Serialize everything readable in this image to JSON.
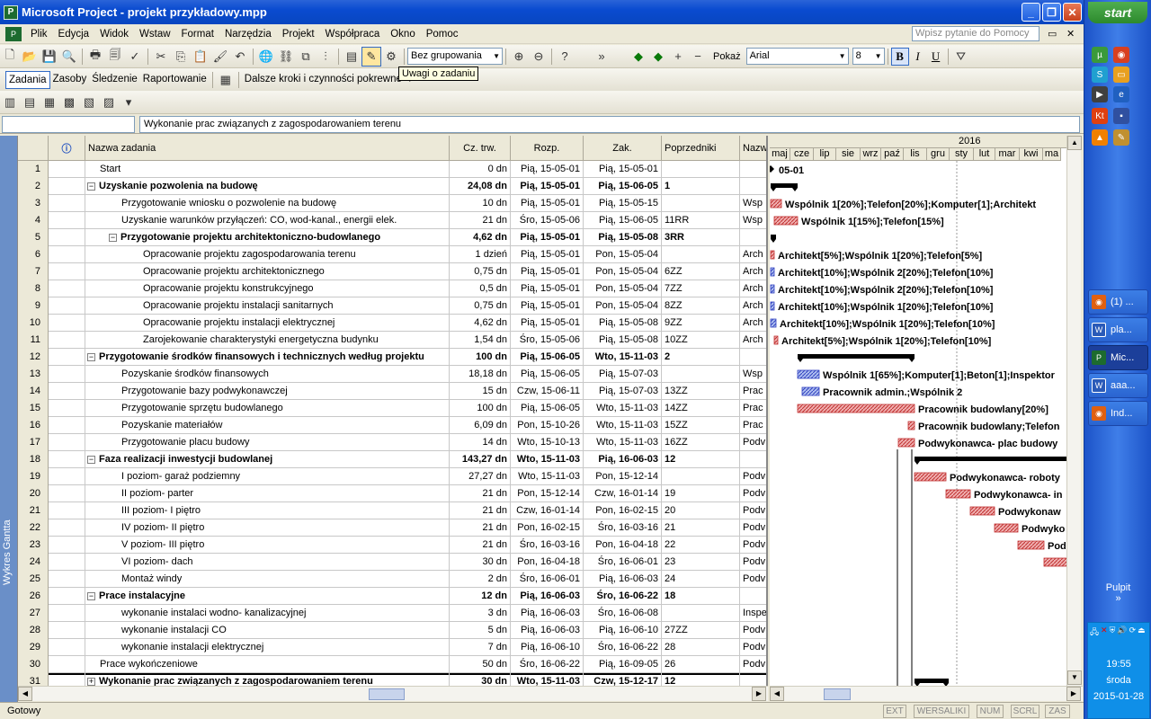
{
  "window": {
    "title": "Microsoft Project - projekt przykładowy.mpp"
  },
  "menu": [
    "Plik",
    "Edycja",
    "Widok",
    "Wstaw",
    "Format",
    "Narzędzia",
    "Projekt",
    "Współpraca",
    "Okno",
    "Pomoc"
  ],
  "ask_placeholder": "Wpisz pytanie do Pomocy",
  "toolbar": {
    "grouping": "Bez grupowania",
    "show_label": "Pokaż",
    "font": "Arial",
    "size": "8"
  },
  "guide": {
    "tabs": [
      "Zadania",
      "Zasoby",
      "Śledzenie",
      "Raportowanie"
    ],
    "next_steps": "Dalsze kroki i czynności pokrewne"
  },
  "tooltip": "Uwagi o zadaniu",
  "entry_value": "Wykonanie prac związanych z zagospodarowaniem terenu",
  "sidebar_label": "Wykres Gantta",
  "columns": [
    "Nazwa zadania",
    "Cz. trw.",
    "Rozp.",
    "Zak.",
    "Poprzedniki",
    "Nazw"
  ],
  "tasks": [
    {
      "id": "1",
      "name": "Start",
      "dur": "0 dn",
      "start": "Pią, 15-05-01",
      "finish": "Pią, 15-05-01",
      "pred": "",
      "res": "",
      "level": 0,
      "summary": false
    },
    {
      "id": "2",
      "name": "Uzyskanie pozwolenia na budowę",
      "dur": "24,08 dn",
      "start": "Pią, 15-05-01",
      "finish": "Pią, 15-06-05",
      "pred": "1",
      "res": "",
      "level": 0,
      "summary": true
    },
    {
      "id": "3",
      "name": "Przygotowanie wniosku o pozwolenie na budowę",
      "dur": "10 dn",
      "start": "Pią, 15-05-01",
      "finish": "Pią, 15-05-15",
      "pred": "",
      "res": "Wsp",
      "level": 1,
      "summary": false
    },
    {
      "id": "4",
      "name": "Uzyskanie warunków przyłączeń: CO, wod-kanal., energii elek.",
      "dur": "21 dn",
      "start": "Śro, 15-05-06",
      "finish": "Pią, 15-06-05",
      "pred": "11RR",
      "res": "Wsp",
      "level": 1,
      "summary": false
    },
    {
      "id": "5",
      "name": "Przygotowanie projektu architektoniczno-budowlanego",
      "dur": "4,62 dn",
      "start": "Pią, 15-05-01",
      "finish": "Pią, 15-05-08",
      "pred": "3RR",
      "res": "",
      "level": 1,
      "summary": true
    },
    {
      "id": "6",
      "name": "Opracowanie projektu zagospodarowania terenu",
      "dur": "1 dzień",
      "start": "Pią, 15-05-01",
      "finish": "Pon, 15-05-04",
      "pred": "",
      "res": "Arch",
      "level": 2,
      "summary": false
    },
    {
      "id": "7",
      "name": "Opracowanie projektu architektonicznego",
      "dur": "0,75 dn",
      "start": "Pią, 15-05-01",
      "finish": "Pon, 15-05-04",
      "pred": "6ZZ",
      "res": "Arch",
      "level": 2,
      "summary": false
    },
    {
      "id": "8",
      "name": "Opracowanie projektu konstrukcyjnego",
      "dur": "0,5 dn",
      "start": "Pią, 15-05-01",
      "finish": "Pon, 15-05-04",
      "pred": "7ZZ",
      "res": "Arch",
      "level": 2,
      "summary": false
    },
    {
      "id": "9",
      "name": "Opracowanie projektu instalacji sanitarnych",
      "dur": "0,75 dn",
      "start": "Pią, 15-05-01",
      "finish": "Pon, 15-05-04",
      "pred": "8ZZ",
      "res": "Arch",
      "level": 2,
      "summary": false
    },
    {
      "id": "10",
      "name": "Opracowanie projektu instalacji elektrycznej",
      "dur": "4,62 dn",
      "start": "Pią, 15-05-01",
      "finish": "Pią, 15-05-08",
      "pred": "9ZZ",
      "res": "Arch",
      "level": 2,
      "summary": false
    },
    {
      "id": "11",
      "name": "Zarojekowanie charakterystyki energetyczna budynku",
      "dur": "1,54 dn",
      "start": "Śro, 15-05-06",
      "finish": "Pią, 15-05-08",
      "pred": "10ZZ",
      "res": "Arch",
      "level": 2,
      "summary": false
    },
    {
      "id": "12",
      "name": "Przygotowanie środków finansowych i technicznych według projektu",
      "dur": "100 dn",
      "start": "Pią, 15-06-05",
      "finish": "Wto, 15-11-03",
      "pred": "2",
      "res": "",
      "level": 0,
      "summary": true
    },
    {
      "id": "13",
      "name": "Pozyskanie środków finansowych",
      "dur": "18,18 dn",
      "start": "Pią, 15-06-05",
      "finish": "Pią, 15-07-03",
      "pred": "",
      "res": "Wsp",
      "level": 1,
      "summary": false
    },
    {
      "id": "14",
      "name": "Przygotowanie bazy podwykonawczej",
      "dur": "15 dn",
      "start": "Czw, 15-06-11",
      "finish": "Pią, 15-07-03",
      "pred": "13ZZ",
      "res": "Prac",
      "level": 1,
      "summary": false
    },
    {
      "id": "15",
      "name": "Przygotowanie sprzętu budowlanego",
      "dur": "100 dn",
      "start": "Pią, 15-06-05",
      "finish": "Wto, 15-11-03",
      "pred": "14ZZ",
      "res": "Prac",
      "level": 1,
      "summary": false
    },
    {
      "id": "16",
      "name": "Pozyskanie materiałów",
      "dur": "6,09 dn",
      "start": "Pon, 15-10-26",
      "finish": "Wto, 15-11-03",
      "pred": "15ZZ",
      "res": "Prac",
      "level": 1,
      "summary": false
    },
    {
      "id": "17",
      "name": "Przygotowanie placu budowy",
      "dur": "14 dn",
      "start": "Wto, 15-10-13",
      "finish": "Wto, 15-11-03",
      "pred": "16ZZ",
      "res": "Podv",
      "level": 1,
      "summary": false
    },
    {
      "id": "18",
      "name": "Faza realizacji inwestycji budowlanej",
      "dur": "143,27 dn",
      "start": "Wto, 15-11-03",
      "finish": "Pią, 16-06-03",
      "pred": "12",
      "res": "",
      "level": 0,
      "summary": true
    },
    {
      "id": "19",
      "name": "I poziom- garaż podziemny",
      "dur": "27,27 dn",
      "start": "Wto, 15-11-03",
      "finish": "Pon, 15-12-14",
      "pred": "",
      "res": "Podv",
      "level": 1,
      "summary": false
    },
    {
      "id": "20",
      "name": "II poziom- parter",
      "dur": "21 dn",
      "start": "Pon, 15-12-14",
      "finish": "Czw, 16-01-14",
      "pred": "19",
      "res": "Podv",
      "level": 1,
      "summary": false
    },
    {
      "id": "21",
      "name": "III poziom- I piętro",
      "dur": "21 dn",
      "start": "Czw, 16-01-14",
      "finish": "Pon, 16-02-15",
      "pred": "20",
      "res": "Podv",
      "level": 1,
      "summary": false
    },
    {
      "id": "22",
      "name": "IV poziom- II piętro",
      "dur": "21 dn",
      "start": "Pon, 16-02-15",
      "finish": "Śro, 16-03-16",
      "pred": "21",
      "res": "Podv",
      "level": 1,
      "summary": false
    },
    {
      "id": "23",
      "name": "V poziom- III piętro",
      "dur": "21 dn",
      "start": "Śro, 16-03-16",
      "finish": "Pon, 16-04-18",
      "pred": "22",
      "res": "Podv",
      "level": 1,
      "summary": false
    },
    {
      "id": "24",
      "name": "VI poziom- dach",
      "dur": "30 dn",
      "start": "Pon, 16-04-18",
      "finish": "Śro, 16-06-01",
      "pred": "23",
      "res": "Podv",
      "level": 1,
      "summary": false
    },
    {
      "id": "25",
      "name": "Montaż windy",
      "dur": "2 dn",
      "start": "Śro, 16-06-01",
      "finish": "Pią, 16-06-03",
      "pred": "24",
      "res": "Podv",
      "level": 1,
      "summary": false
    },
    {
      "id": "26",
      "name": "Prace instalacyjne",
      "dur": "12 dn",
      "start": "Pią, 16-06-03",
      "finish": "Śro, 16-06-22",
      "pred": "18",
      "res": "",
      "level": 0,
      "summary": true
    },
    {
      "id": "27",
      "name": "wykonanie instalaci wodno- kanalizacyjnej",
      "dur": "3 dn",
      "start": "Pią, 16-06-03",
      "finish": "Śro, 16-06-08",
      "pred": "",
      "res": "Inspe",
      "level": 1,
      "summary": false
    },
    {
      "id": "28",
      "name": "wykonanie instalacji CO",
      "dur": "5 dn",
      "start": "Pią, 16-06-03",
      "finish": "Pią, 16-06-10",
      "pred": "27ZZ",
      "res": "Podv",
      "level": 1,
      "summary": false
    },
    {
      "id": "29",
      "name": "wykonanie instalacji elektrycznej",
      "dur": "7 dn",
      "start": "Pią, 16-06-10",
      "finish": "Śro, 16-06-22",
      "pred": "28",
      "res": "Podv",
      "level": 1,
      "summary": false
    },
    {
      "id": "30",
      "name": "Prace wykończeniowe",
      "dur": "50 dn",
      "start": "Śro, 16-06-22",
      "finish": "Pią, 16-09-05",
      "pred": "26",
      "res": "Podv",
      "level": 0,
      "summary": false
    },
    {
      "id": "31",
      "name": "Wykonanie prac związanych z zagospodarowaniem terenu",
      "dur": "30 dn",
      "start": "Wto, 15-11-03",
      "finish": "Czw, 15-12-17",
      "pred": "12",
      "res": "",
      "level": 0,
      "summary": true,
      "collapsed": true
    }
  ],
  "timescale": {
    "year": "2016",
    "months": [
      "maj",
      "cze",
      "lip",
      "sie",
      "wrz",
      "paź",
      "lis",
      "gru",
      "sty",
      "lut",
      "mar",
      "kwi",
      "ma"
    ]
  },
  "gantt_labels": [
    "05-01",
    "",
    "Wspólnik 1[20%];Telefon[20%];Komputer[1];Architekt",
    "Wspólnik 1[15%];Telefon[15%]",
    "",
    "Architekt[5%];Wspólnik 1[20%];Telefon[5%]",
    "Architekt[10%];Wspólnik 2[20%];Telefon[10%]",
    "Architekt[10%];Wspólnik 2[20%];Telefon[10%]",
    "Architekt[10%];Wspólnik 1[20%];Telefon[10%]",
    "Architekt[10%];Wspólnik 1[20%];Telefon[10%]",
    "Architekt[5%];Wspólnik 1[20%];Telefon[10%]",
    "",
    "Wspólnik 1[65%];Komputer[1];Beton[1];Inspektor",
    "Pracownik admin.;Wspólnik 2",
    "Pracownik budowlany[20%]",
    "Pracownik budowlany;Telefon",
    "Podwykonawca- plac budowy",
    "",
    "Podwykonawca- roboty",
    "Podwykonawca- in",
    "Podwykonaw",
    "Podwyko",
    "Pod",
    "",
    "",
    "",
    "",
    "",
    "",
    "",
    ""
  ],
  "status": {
    "ready": "Gotowy",
    "indicators": [
      "EXT",
      "WERSALIKI",
      "NUM",
      "SCRL",
      "ZAS"
    ]
  },
  "taskbar": {
    "start": "start",
    "buttons": [
      "(1) ...",
      "pla...",
      "Mic...",
      "aaa...",
      "Ind..."
    ],
    "desktop": "Pulpit",
    "time": "19:55",
    "day": "środa",
    "date": "2015-01-28"
  }
}
